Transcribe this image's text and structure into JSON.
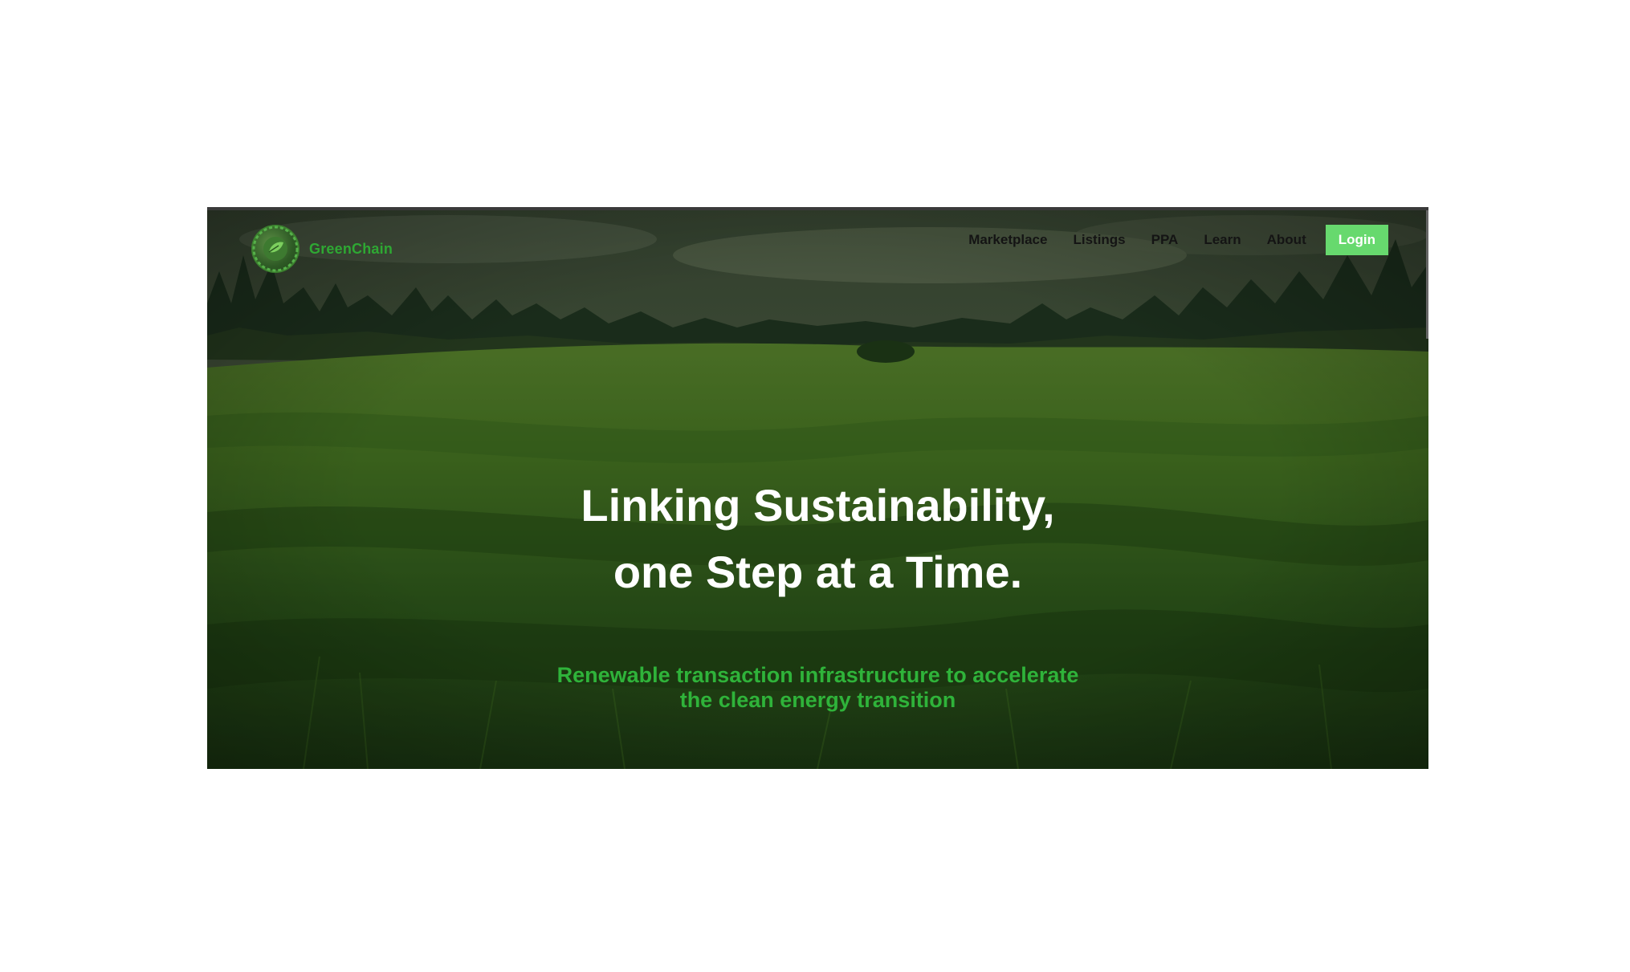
{
  "brand": {
    "name": "GreenChain",
    "logo_icon": "globe-leaf-icon",
    "accent_color": "#2ea833"
  },
  "nav": {
    "items": [
      {
        "label": "Marketplace"
      },
      {
        "label": "Listings"
      },
      {
        "label": "PPA"
      },
      {
        "label": "Learn"
      },
      {
        "label": "About"
      }
    ],
    "login_label": "Login",
    "login_color": "#67d96e"
  },
  "hero": {
    "headline_line1": "Linking Sustainability,",
    "headline_line2": "one Step at a Time.",
    "subheadline_line1": "Renewable transaction infrastructure to accelerate",
    "subheadline_line2": "the clean energy transition",
    "background": "grass-field-with-forest-photo"
  }
}
